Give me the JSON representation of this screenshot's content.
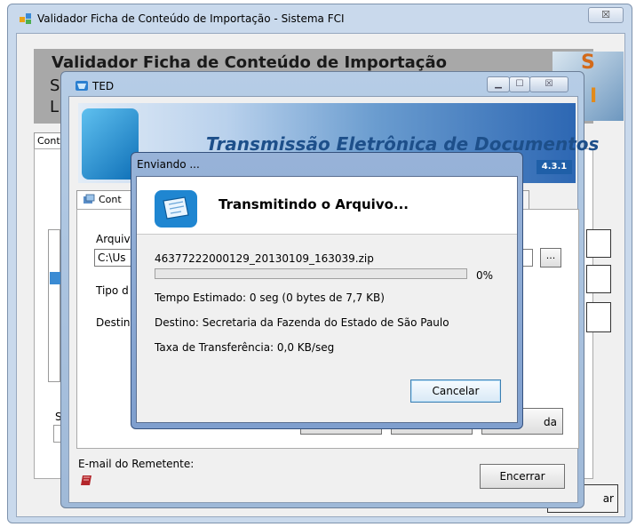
{
  "main_window": {
    "title": "Validador Ficha de Conteúdo de Importação - Sistema FCI",
    "close_label": "☒",
    "header_title": "Validador Ficha de Conteúdo de Importação",
    "header_line2": "S",
    "header_line3": "L",
    "tab_label": "Cont",
    "left_label_s": "S",
    "fechar_label": "ar"
  },
  "ted_window": {
    "title": "TED",
    "min_label": "▁",
    "max_label": "☐",
    "close_label": "☒",
    "banner_title": "Transmissão Eletrônica de Documentos",
    "version": "4.3.1",
    "tab_label": "Cont",
    "arquivo_label": "Arquivo",
    "arquivo_value": "C:\\Us",
    "browse_label": "...",
    "tipo_label": "Tipo d",
    "destino_label": "Destin",
    "button3_label": "da",
    "email_label": "E-mail do Remetente:",
    "encerrar_label": "Encerrar"
  },
  "sending_dialog": {
    "title": "Enviando ...",
    "header_title": "Transmitindo o Arquivo...",
    "filename": "46377222000129_20130109_163039.zip",
    "progress_percent": 0,
    "percent_label": "0%",
    "tempo_estimado": "Tempo Estimado:  0 seg (0 bytes de 7,7 KB)",
    "destino": "Destino:  Secretaria da Fazenda do Estado de São Paulo",
    "taxa": "Taxa de Transferência:  0,0 KB/seg",
    "cancel_label": "Cancelar"
  },
  "colors": {
    "progress_fill": "#37b337",
    "banner_accent": "#2d67b3"
  }
}
